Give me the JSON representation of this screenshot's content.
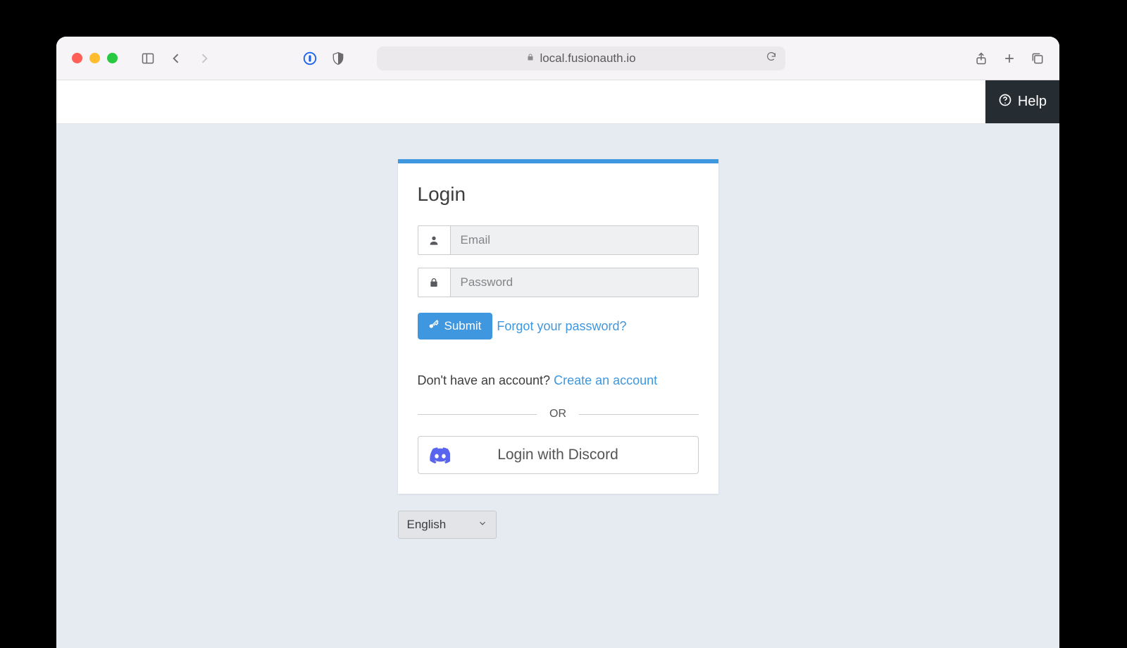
{
  "browser": {
    "url_display": "local.fusionauth.io"
  },
  "header": {
    "help_label": "Help"
  },
  "login": {
    "title": "Login",
    "email_placeholder": "Email",
    "email_value": "",
    "password_placeholder": "Password",
    "password_value": "",
    "submit_label": "Submit",
    "forgot_label": "Forgot your password?",
    "no_account_text": "Don't have an account? ",
    "create_account_label": "Create an account",
    "or_label": "OR",
    "discord_label": "Login with Discord"
  },
  "language": {
    "selected": "English"
  }
}
